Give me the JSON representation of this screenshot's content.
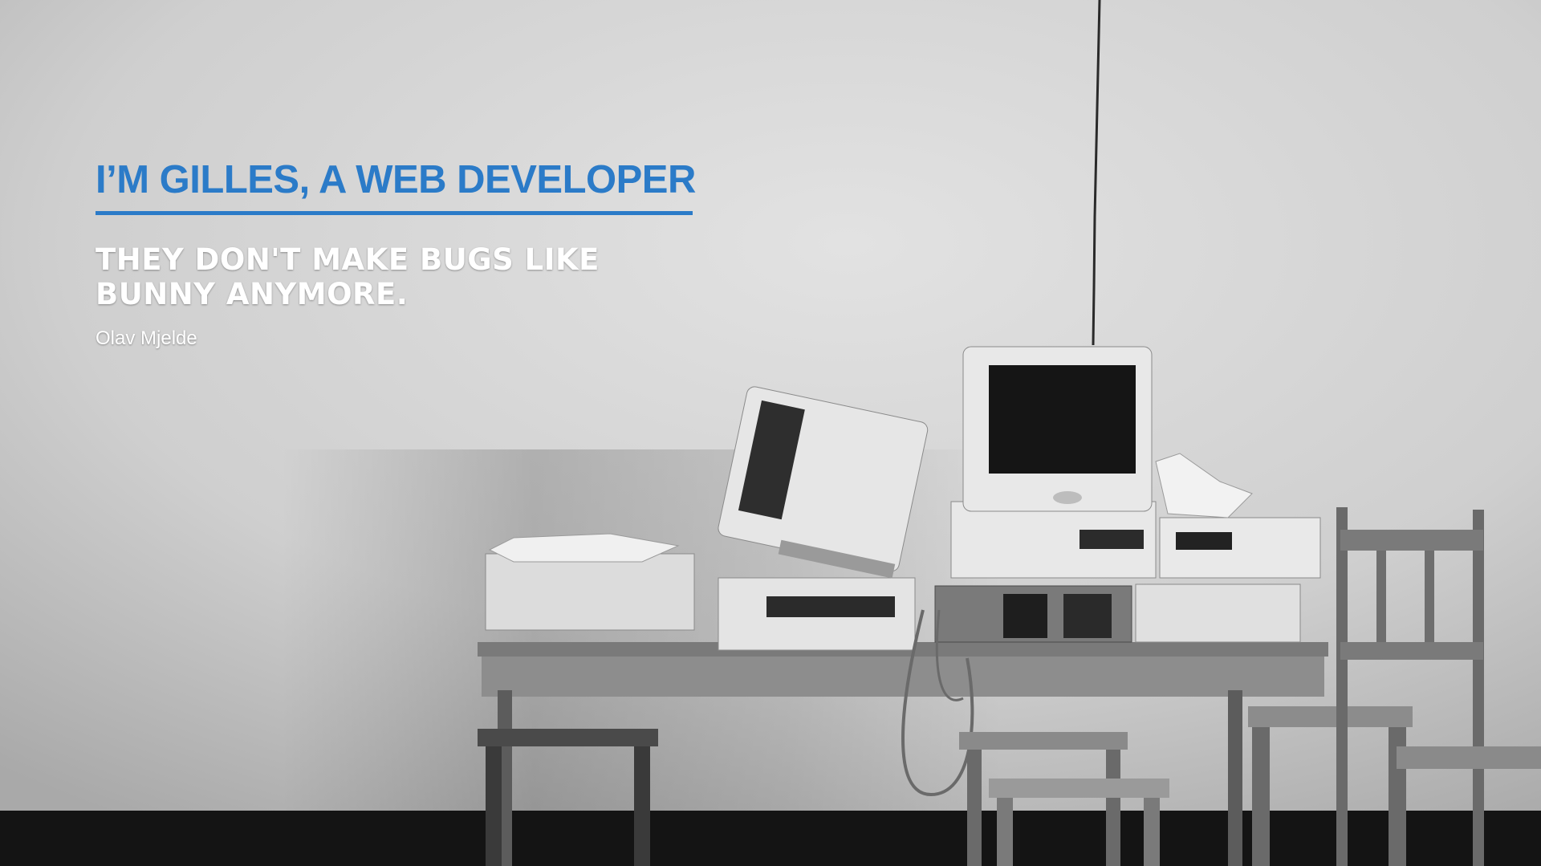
{
  "hero": {
    "title": "I’M GILLES, A WEB DEVELOPER",
    "quote_line_1": "THEY DON'T MAKE BUGS LIKE",
    "quote_line_2": "BUNNY ANYMORE.",
    "author": "Olav Mjelde"
  },
  "colors": {
    "accent": "#2b7bc8",
    "quote_text": "#ffffff",
    "wall": "#d4d4d4",
    "floor": "#141414"
  },
  "background": {
    "description_icon": "photo-old-computers-on-table"
  }
}
